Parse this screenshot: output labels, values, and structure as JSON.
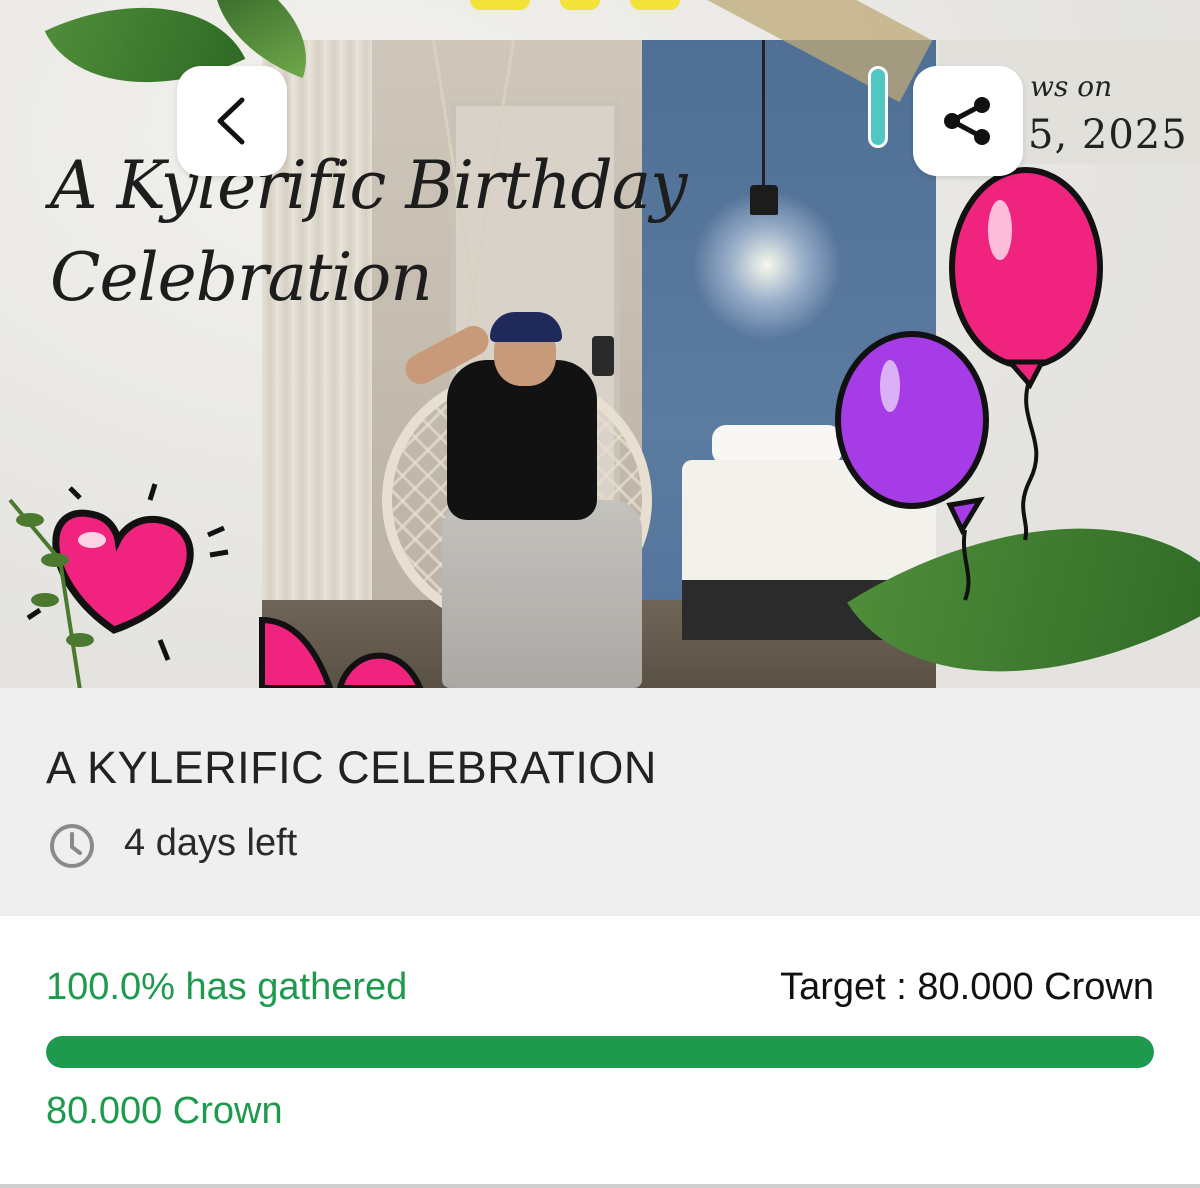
{
  "banner": {
    "script_title_line1": "A Kylerific Birthday",
    "script_title_line2": "Celebration",
    "date_line1": "ws on",
    "date_line2": "5, 2025"
  },
  "nav": {
    "back_icon": "chevron-left-icon",
    "share_icon": "share-icon"
  },
  "event": {
    "title": "A KYLERIFIC CELEBRATION",
    "time_icon": "clock-icon",
    "days_left": "4 days left"
  },
  "funding": {
    "gathered_label": "100.0% has gathered",
    "target_label": "Target : 80.000 Crown",
    "progress_fraction": 1.0,
    "amount_label": "80.000 Crown",
    "accent_color": "#1e9a4e"
  }
}
